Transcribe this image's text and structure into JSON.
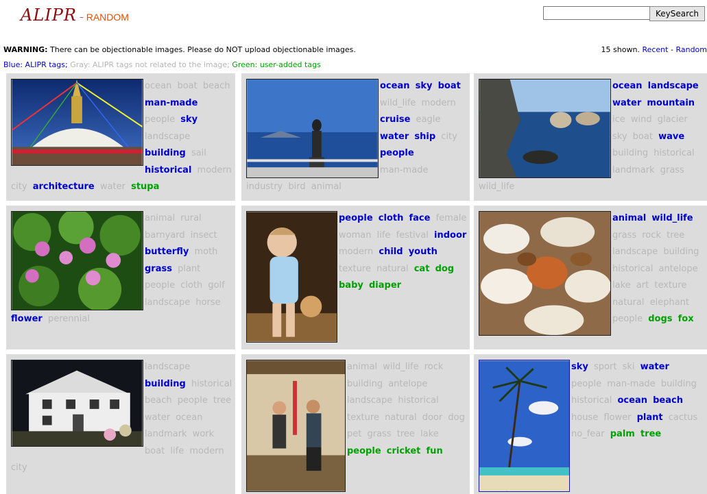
{
  "header": {
    "logo_main": "ALIPR",
    "logo_sub": "RANDOM",
    "search_value": "",
    "search_button": "KeySearch"
  },
  "warning": {
    "bold": "WARNING:",
    "text": " There can be objectionable images. Please do NOT upload objectionable images."
  },
  "shown": {
    "count_text": "15 shown.",
    "recent": "Recent",
    "sep": " - ",
    "random": "Random"
  },
  "legend": {
    "blue": "Blue: ALIPR tags;",
    "gray": "Gray: ALIPR tags not related to the image;",
    "green": "Green: user-added tags"
  },
  "colors": {
    "blue": "#0000cc",
    "gray": "#b8b8b8",
    "green": "#00a000",
    "cell_bg": "#dcdcdc",
    "logo": "#8a0e0e",
    "logo_sub": "#e05000"
  },
  "cells": [
    {
      "image": "stupa-photo",
      "tags": [
        [
          "ocean",
          "gray"
        ],
        [
          "boat",
          "gray"
        ],
        [
          "beach",
          "gray"
        ],
        [
          "man-made",
          "blue"
        ],
        [
          "people",
          "gray"
        ],
        [
          "sky",
          "blue"
        ],
        [
          "landscape",
          "gray"
        ],
        [
          "building",
          "blue"
        ],
        [
          "sail",
          "gray"
        ],
        [
          "historical",
          "blue"
        ],
        [
          "modern",
          "gray"
        ],
        [
          "city",
          "gray"
        ],
        [
          "architecture",
          "blue"
        ],
        [
          "water",
          "gray"
        ],
        [
          "stupa",
          "green"
        ]
      ]
    },
    {
      "image": "woman-on-boat-photo",
      "tags": [
        [
          "ocean",
          "blue"
        ],
        [
          "sky",
          "blue"
        ],
        [
          "boat",
          "blue"
        ],
        [
          "wild_life",
          "gray"
        ],
        [
          "modern",
          "gray"
        ],
        [
          "cruise",
          "blue"
        ],
        [
          "eagle",
          "gray"
        ],
        [
          "water",
          "blue"
        ],
        [
          "ship",
          "blue"
        ],
        [
          "city",
          "gray"
        ],
        [
          "people",
          "blue"
        ],
        [
          "man-made",
          "gray"
        ],
        [
          "industry",
          "gray"
        ],
        [
          "bird",
          "gray"
        ],
        [
          "animal",
          "gray"
        ]
      ]
    },
    {
      "image": "coastal-rocks-photo",
      "tags": [
        [
          "ocean",
          "blue"
        ],
        [
          "landscape",
          "blue"
        ],
        [
          "water",
          "blue"
        ],
        [
          "mountain",
          "blue"
        ],
        [
          "ice",
          "gray"
        ],
        [
          "wind",
          "gray"
        ],
        [
          "glacier",
          "gray"
        ],
        [
          "sky",
          "gray"
        ],
        [
          "boat",
          "gray"
        ],
        [
          "wave",
          "blue"
        ],
        [
          "building",
          "gray"
        ],
        [
          "historical",
          "gray"
        ],
        [
          "landmark",
          "gray"
        ],
        [
          "grass",
          "gray"
        ],
        [
          "wild_life",
          "gray"
        ]
      ]
    },
    {
      "image": "water-lilies-photo",
      "tags": [
        [
          "animal",
          "gray"
        ],
        [
          "rural",
          "gray"
        ],
        [
          "barnyard",
          "gray"
        ],
        [
          "insect",
          "gray"
        ],
        [
          "butterfly",
          "blue"
        ],
        [
          "moth",
          "gray"
        ],
        [
          "grass",
          "blue"
        ],
        [
          "plant",
          "gray"
        ],
        [
          "people",
          "gray"
        ],
        [
          "cloth",
          "gray"
        ],
        [
          "golf",
          "gray"
        ],
        [
          "landscape",
          "gray"
        ],
        [
          "horse",
          "gray"
        ],
        [
          "flower",
          "blue"
        ],
        [
          "perennial",
          "gray"
        ]
      ]
    },
    {
      "image": "toddler-photo",
      "tags": [
        [
          "people",
          "blue"
        ],
        [
          "cloth",
          "blue"
        ],
        [
          "face",
          "blue"
        ],
        [
          "female",
          "gray"
        ],
        [
          "woman",
          "gray"
        ],
        [
          "life",
          "gray"
        ],
        [
          "festival",
          "gray"
        ],
        [
          "indoor",
          "blue"
        ],
        [
          "modern",
          "gray"
        ],
        [
          "child",
          "blue"
        ],
        [
          "youth",
          "blue"
        ],
        [
          "texture",
          "gray"
        ],
        [
          "natural",
          "gray"
        ],
        [
          "cat",
          "green"
        ],
        [
          "dog",
          "green"
        ],
        [
          "baby",
          "green"
        ],
        [
          "diaper",
          "green"
        ]
      ]
    },
    {
      "image": "hounds-and-fox-photo",
      "tags": [
        [
          "animal",
          "blue"
        ],
        [
          "wild_life",
          "blue"
        ],
        [
          "grass",
          "gray"
        ],
        [
          "rock",
          "gray"
        ],
        [
          "tree",
          "gray"
        ],
        [
          "landscape",
          "gray"
        ],
        [
          "building",
          "gray"
        ],
        [
          "historical",
          "gray"
        ],
        [
          "antelope",
          "gray"
        ],
        [
          "lake",
          "gray"
        ],
        [
          "art",
          "gray"
        ],
        [
          "texture",
          "gray"
        ],
        [
          "natural",
          "gray"
        ],
        [
          "elephant",
          "gray"
        ],
        [
          "people",
          "gray"
        ],
        [
          "dogs",
          "green"
        ],
        [
          "fox",
          "green"
        ]
      ]
    },
    {
      "image": "house-at-night-photo",
      "tags": [
        [
          "landscape",
          "gray"
        ],
        [
          "building",
          "blue"
        ],
        [
          "historical",
          "gray"
        ],
        [
          "beach",
          "gray"
        ],
        [
          "people",
          "gray"
        ],
        [
          "tree",
          "gray"
        ],
        [
          "water",
          "gray"
        ],
        [
          "ocean",
          "gray"
        ],
        [
          "landmark",
          "gray"
        ],
        [
          "work",
          "gray"
        ],
        [
          "boat",
          "gray"
        ],
        [
          "life",
          "gray"
        ],
        [
          "modern",
          "gray"
        ],
        [
          "city",
          "gray"
        ]
      ]
    },
    {
      "image": "cricket-players-photo",
      "tags": [
        [
          "animal",
          "gray"
        ],
        [
          "wild_life",
          "gray"
        ],
        [
          "rock",
          "gray"
        ],
        [
          "building",
          "gray"
        ],
        [
          "antelope",
          "gray"
        ],
        [
          "landscape",
          "gray"
        ],
        [
          "historical",
          "gray"
        ],
        [
          "texture",
          "gray"
        ],
        [
          "natural",
          "gray"
        ],
        [
          "door",
          "gray"
        ],
        [
          "dog",
          "gray"
        ],
        [
          "pet",
          "gray"
        ],
        [
          "grass",
          "gray"
        ],
        [
          "tree",
          "gray"
        ],
        [
          "lake",
          "gray"
        ],
        [
          "people",
          "green"
        ],
        [
          "cricket",
          "green"
        ],
        [
          "fun",
          "green"
        ]
      ]
    },
    {
      "image": "palm-tree-photo",
      "tags": [
        [
          "sky",
          "blue"
        ],
        [
          "sport",
          "gray"
        ],
        [
          "ski",
          "gray"
        ],
        [
          "water",
          "blue"
        ],
        [
          "people",
          "gray"
        ],
        [
          "man-made",
          "gray"
        ],
        [
          "building",
          "gray"
        ],
        [
          "historical",
          "gray"
        ],
        [
          "ocean",
          "blue"
        ],
        [
          "beach",
          "blue"
        ],
        [
          "house",
          "gray"
        ],
        [
          "flower",
          "gray"
        ],
        [
          "plant",
          "blue"
        ],
        [
          "cactus",
          "gray"
        ],
        [
          "no_fear",
          "gray"
        ],
        [
          "palm",
          "green"
        ],
        [
          "tree",
          "green"
        ]
      ]
    }
  ]
}
